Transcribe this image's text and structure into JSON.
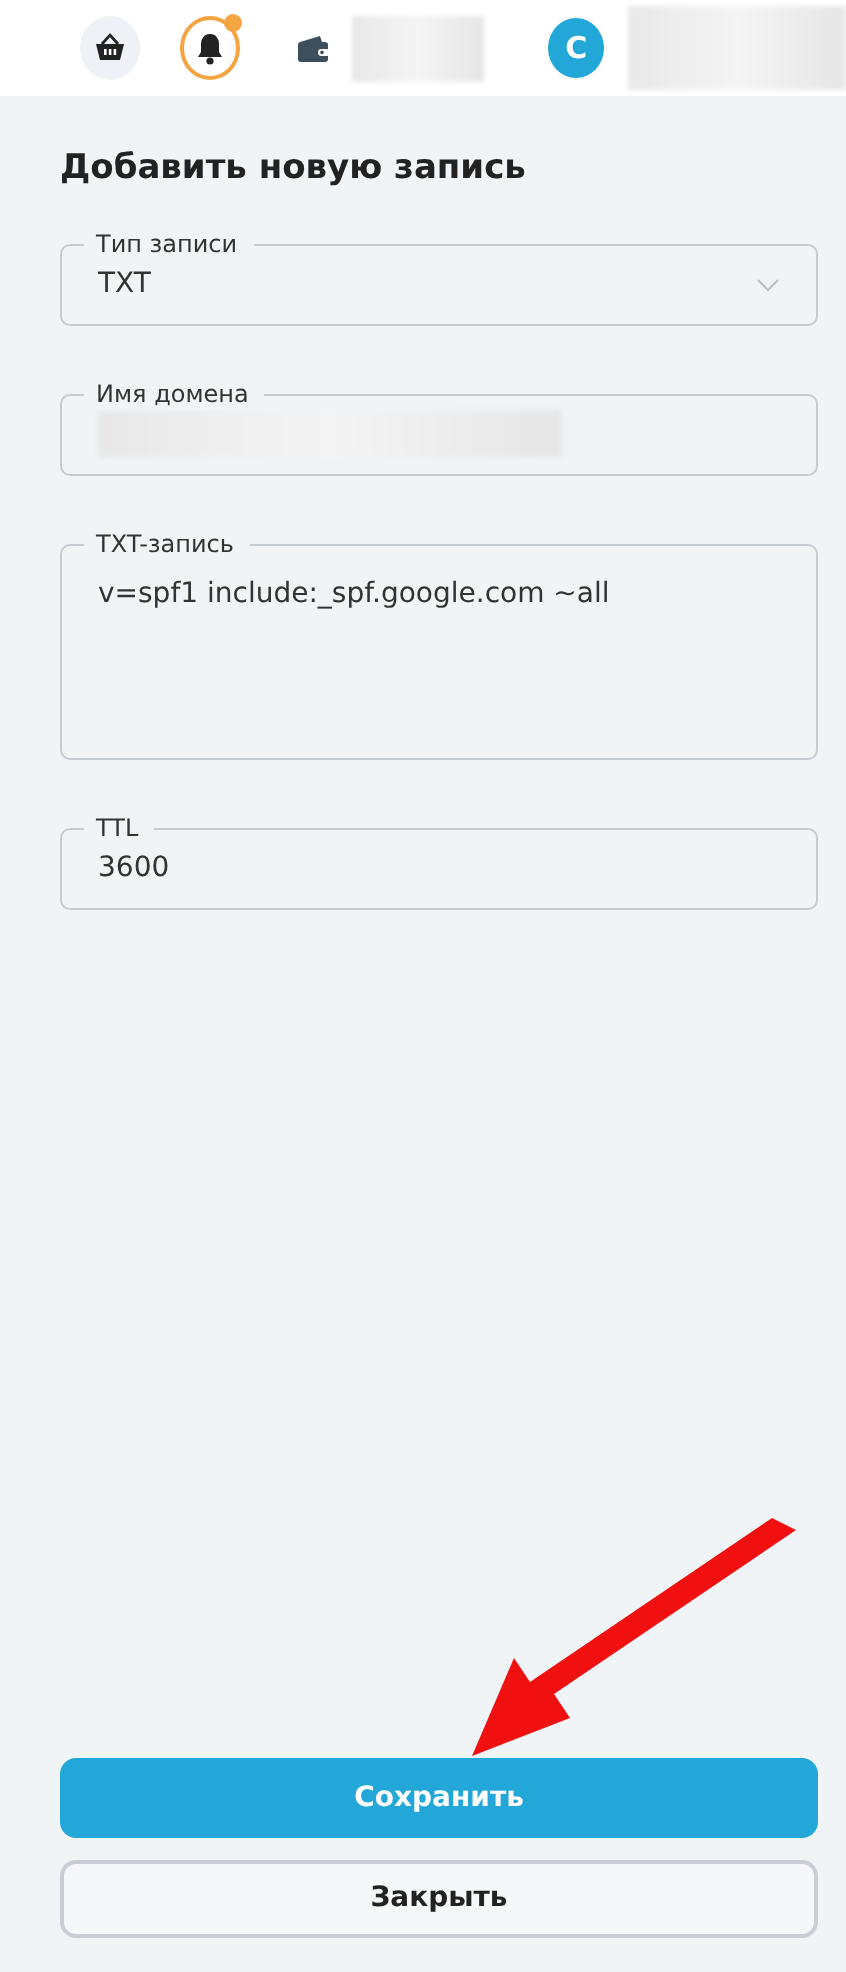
{
  "header": {
    "notifications_unread": true,
    "balance_redacted": true,
    "avatar_letter": "С",
    "user_redacted": true
  },
  "title": "Добавить новую запись",
  "fields": [
    {
      "kind": "select",
      "label": "Тип записи",
      "value": "TXT"
    },
    {
      "kind": "input",
      "label": "Имя домена",
      "redacted": true
    },
    {
      "kind": "textarea",
      "label": "TXT-запись",
      "value": "v=spf1 include:_spf.google.com ~all"
    },
    {
      "kind": "input",
      "label": "TTL",
      "value": "3600"
    }
  ],
  "buttons": [
    {
      "kind": "primary",
      "label": "Сохранить"
    },
    {
      "kind": "secondary",
      "label": "Закрыть"
    }
  ]
}
